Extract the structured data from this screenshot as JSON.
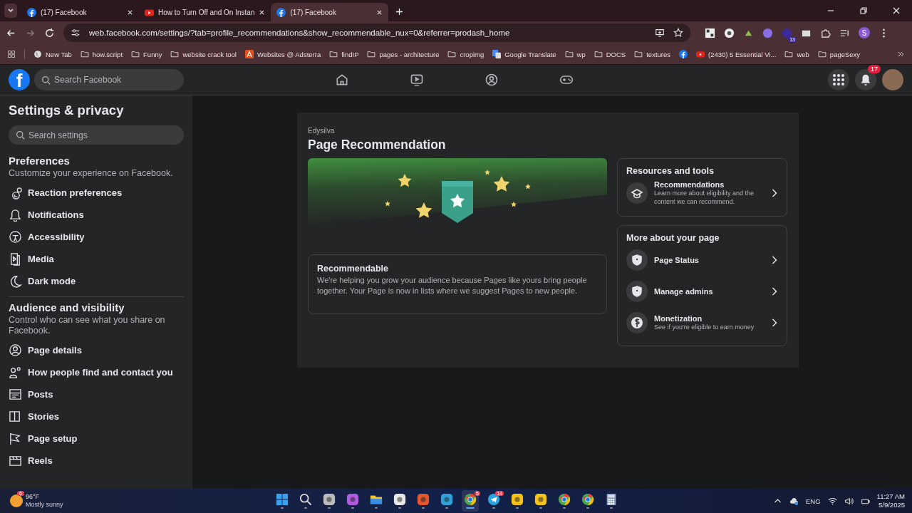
{
  "browser": {
    "tabs": [
      {
        "kind": "facebook",
        "title": "(17) Facebook",
        "selected": false
      },
      {
        "kind": "youtube",
        "title": "How to Turn Off and On Instan",
        "selected": false
      },
      {
        "kind": "facebook",
        "title": "(17) Facebook",
        "selected": true
      }
    ],
    "url": "web.facebook.com/settings/?tab=profile_recommendations&show_recommendable_nux=0&referrer=prodash_home",
    "extension_badge": "13",
    "profile_initial": "S",
    "bookmarks": [
      {
        "kind": "globe",
        "label": "New Tab"
      },
      {
        "kind": "folder",
        "label": "how.script"
      },
      {
        "kind": "folder",
        "label": "Funny"
      },
      {
        "kind": "folder",
        "label": "website crack tool"
      },
      {
        "kind": "adsterra",
        "label": "Websites @ Adsterra"
      },
      {
        "kind": "folder",
        "label": "findIP"
      },
      {
        "kind": "folder",
        "label": "pages - architecture"
      },
      {
        "kind": "folder",
        "label": "cropimg"
      },
      {
        "kind": "translate",
        "label": "Google Translate"
      },
      {
        "kind": "folder",
        "label": "wp"
      },
      {
        "kind": "folder",
        "label": "DOCS"
      },
      {
        "kind": "folder",
        "label": "textures"
      },
      {
        "kind": "facebook"
      },
      {
        "kind": "youtube",
        "label": "(2430) 5 Essential Vi..."
      },
      {
        "kind": "folder",
        "label": "web"
      },
      {
        "kind": "folder",
        "label": "pageSexy"
      }
    ]
  },
  "header": {
    "logo_letter": "f",
    "search": {
      "placeholder": "Search Facebook"
    },
    "notification_badge": "17"
  },
  "sidebar": {
    "title": "Settings & privacy",
    "search": {
      "placeholder": "Search settings"
    },
    "sections": [
      {
        "heading": "Preferences",
        "description": "Customize your experience on Facebook.",
        "items": [
          "Reaction preferences",
          "Notifications",
          "Accessibility",
          "Media",
          "Dark mode"
        ]
      },
      {
        "heading": "Audience and visibility",
        "description": "Control who can see what you share on Facebook.",
        "items": [
          "Page details",
          "How people find and contact you",
          "Posts",
          "Stories",
          "Page setup",
          "Reels"
        ]
      }
    ]
  },
  "main": {
    "page_name": "Edysilva",
    "title": "Page Recommendation",
    "status": {
      "title": "Recommendable",
      "text": "We're helping you grow your audience because Pages like yours bring people together. Your Page is now in lists where we suggest Pages to new people."
    },
    "panels": [
      {
        "title": "Resources and tools",
        "items": [
          {
            "kind": "cap",
            "label": "Recommendations",
            "description": "Learn more about eligibility and the content we can recommend."
          }
        ]
      },
      {
        "title": "More about your page",
        "items": [
          {
            "kind": "shield",
            "label": "Page Status"
          },
          {
            "kind": "shield",
            "label": "Manage admins"
          },
          {
            "kind": "dollar",
            "label": "Monetization",
            "description": "See if you're eligible to earn money"
          }
        ]
      }
    ]
  },
  "taskbar": {
    "weather": {
      "badge": "6",
      "temperature": "96°F",
      "condition": "Mostly sunny"
    },
    "apps": [
      {
        "kind": "windows",
        "selected": false
      },
      {
        "kind": "search",
        "selected": false
      },
      {
        "kind": "taskview",
        "selected": false
      },
      {
        "kind": "copilot",
        "selected": false
      },
      {
        "kind": "files",
        "selected": false
      },
      {
        "kind": "store",
        "selected": false
      },
      {
        "kind": "remote",
        "selected": false
      },
      {
        "kind": "edge",
        "selected": false
      },
      {
        "kind": "chrome",
        "badge": "5",
        "selected": true
      },
      {
        "kind": "telegram",
        "badge": "14",
        "selected": false
      },
      {
        "kind": "yellowapp",
        "selected": false
      },
      {
        "kind": "yellowring",
        "selected": false
      },
      {
        "kind": "chrome",
        "selected": false
      },
      {
        "kind": "chrome",
        "selected": false
      },
      {
        "kind": "calculator",
        "selected": false
      }
    ],
    "language": "ENG",
    "time": "11:27 AM",
    "date": "5/9/2025"
  }
}
